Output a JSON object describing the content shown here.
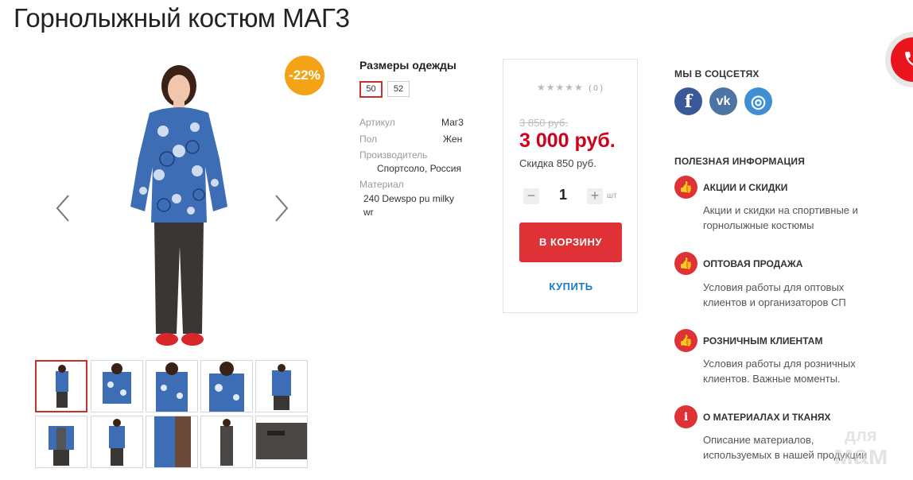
{
  "product": {
    "title": "Горнолыжный костюм МАГ3",
    "discount_badge": "-22%"
  },
  "specs": {
    "sizes_title": "Размеры одежды",
    "sizes": [
      "50",
      "52"
    ],
    "selected_size": "50",
    "article_label": "Артикул",
    "article_value": "Маг3",
    "gender_label": "Пол",
    "gender_value": "Жен",
    "maker_label": "Производитель",
    "maker_value": "Спортсоло, Россия",
    "material_label": "Материал",
    "material_value": "240 Dewspo pu milky wr"
  },
  "buy": {
    "stars": "★★★★★",
    "rating_count": "( 0 )",
    "old_price": "3 850 руб.",
    "new_price": "3 000 руб.",
    "saving": "Скидка 850 руб.",
    "qty_minus": "−",
    "qty": "1",
    "qty_plus": "+",
    "qty_unit": "шт",
    "cart_label": "В КОРЗИНУ",
    "buy_label": "КУПИТЬ"
  },
  "social": {
    "title": "МЫ В СОЦСЕТЯХ",
    "networks": [
      {
        "name": "facebook",
        "glyph": "f",
        "color": "#3b5998"
      },
      {
        "name": "vkontakte",
        "glyph": "vk",
        "color": "#4c75a3"
      },
      {
        "name": "instagram",
        "glyph": "◎",
        "color": "#3f8fd2"
      }
    ]
  },
  "info": {
    "title": "ПОЛЕЗНАЯ ИНФОРМАЦИЯ",
    "items": [
      {
        "icon": "thumbs-up-icon",
        "glyph": "👍",
        "title": "АКЦИИ И СКИДКИ",
        "desc": "Акции и скидки на спортивные и горнолыжные костюмы"
      },
      {
        "icon": "thumbs-up-icon",
        "glyph": "👍",
        "title": "ОПТОВАЯ ПРОДАЖА",
        "desc": "Условия работы для оптовых клиентов и организаторов СП"
      },
      {
        "icon": "thumbs-up-icon",
        "glyph": "👍",
        "title": "РОЗНИЧНЫМ КЛИЕНТАМ",
        "desc": "Условия работы для розничных клиентов. Важные моменты."
      },
      {
        "icon": "info-icon",
        "glyph": "i",
        "title": "О МАТЕРИАЛАХ И ТКАНЯХ",
        "desc": "Описание материалов, используемых в нашей продукции"
      }
    ]
  },
  "watermark": {
    "line1": "для",
    "line2": "мам"
  },
  "colors": {
    "accent_red": "#de3236",
    "price_red": "#d0021b",
    "badge_orange": "#f4a317",
    "link_blue": "#1c7bc4"
  }
}
